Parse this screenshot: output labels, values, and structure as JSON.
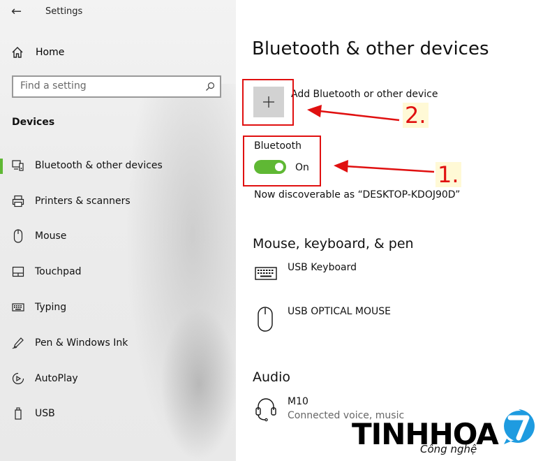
{
  "window": {
    "title": "Settings"
  },
  "sidebar": {
    "home_label": "Home",
    "search": {
      "placeholder": "Find a setting"
    },
    "section_title": "Devices",
    "items": [
      {
        "label": "Bluetooth & other devices",
        "icon": "bluetooth-devices-icon",
        "active": true
      },
      {
        "label": "Printers & scanners",
        "icon": "printer-icon"
      },
      {
        "label": "Mouse",
        "icon": "mouse-icon"
      },
      {
        "label": "Touchpad",
        "icon": "touchpad-icon"
      },
      {
        "label": "Typing",
        "icon": "keyboard-icon"
      },
      {
        "label": "Pen & Windows Ink",
        "icon": "pen-icon"
      },
      {
        "label": "AutoPlay",
        "icon": "autoplay-icon"
      },
      {
        "label": "USB",
        "icon": "usb-icon"
      }
    ]
  },
  "main": {
    "title": "Bluetooth & other devices",
    "add_device_label": "Add Bluetooth or other device",
    "bluetooth": {
      "label": "Bluetooth",
      "state": "On",
      "enabled": true
    },
    "discoverable_text": "Now discoverable as “DESKTOP-KDOJ90D”",
    "sections": {
      "input": {
        "heading": "Mouse, keyboard, & pen",
        "devices": [
          {
            "name": "USB Keyboard",
            "icon": "keyboard-icon"
          },
          {
            "name": "USB OPTICAL MOUSE",
            "icon": "mouse-icon"
          }
        ]
      },
      "audio": {
        "heading": "Audio",
        "devices": [
          {
            "name": "M10",
            "status": "Connected voice, music",
            "icon": "headset-icon"
          }
        ]
      }
    }
  },
  "annotations": {
    "callout_1": "1.",
    "callout_2": "2.",
    "color": "#e01010"
  },
  "watermark": {
    "brand": "TINHHOA",
    "tagline": "Công nghệ",
    "logo_text": "7"
  },
  "colors": {
    "accent": "#5fb834",
    "annotation": "#e01010"
  }
}
